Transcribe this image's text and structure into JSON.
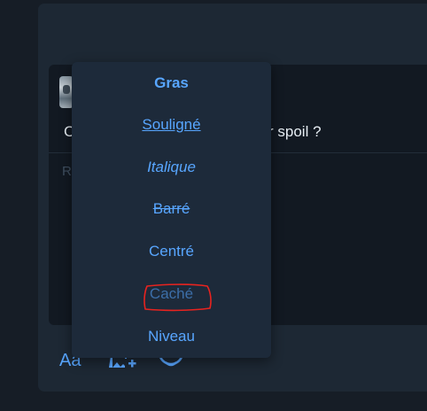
{
  "colors": {
    "background": "#161d26",
    "panel": "#1d2834",
    "card": "#121922",
    "menu": "#1d2a3a",
    "accent": "#58a6ff",
    "muted_accent": "#3c6ea8",
    "text": "#e6edf3",
    "placeholder": "#3f4f60",
    "annotation_red": "#e8231f"
  },
  "post": {
    "question_start": "C",
    "question_end": "r spoil ?",
    "reply_placeholder": "R"
  },
  "toolbar": {
    "format_label": "Aa",
    "format_icon": "text-format-icon",
    "image_icon": "add-image-icon",
    "emoji_icon": "emoji-icon"
  },
  "format_menu": {
    "items": [
      {
        "label": "Gras",
        "style": "bold"
      },
      {
        "label": "Souligné",
        "style": "underline"
      },
      {
        "label": "Italique",
        "style": "italic"
      },
      {
        "label": "Barré",
        "style": "strikethrough"
      },
      {
        "label": "Centré",
        "style": "center"
      },
      {
        "label": "Caché",
        "style": "hidden"
      },
      {
        "label": "Niveau",
        "style": "level"
      }
    ]
  },
  "annotation": {
    "shape": "hand-drawn red rectangle",
    "target": "Caché"
  }
}
